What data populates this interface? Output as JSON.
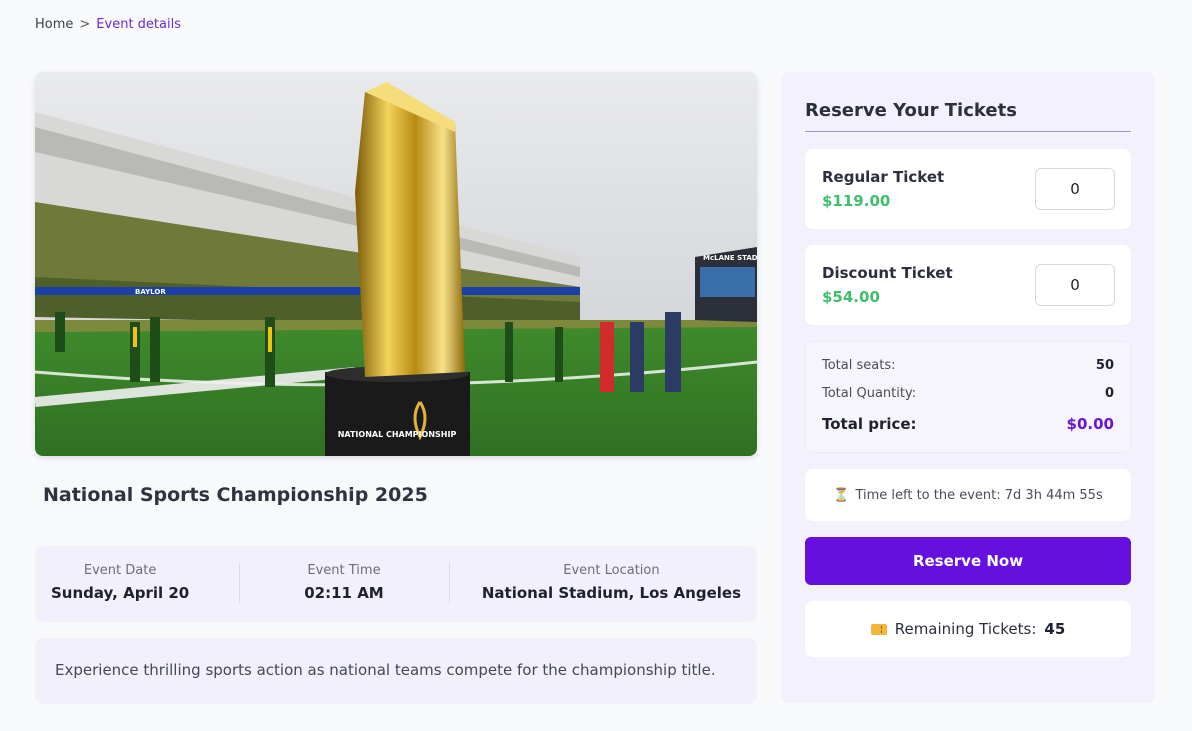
{
  "breadcrumb": {
    "home": "Home",
    "separator": ">",
    "current": "Event details"
  },
  "event": {
    "title": "National Sports Championship 2025",
    "date_label": "Event Date",
    "date_value": "Sunday, April 20",
    "time_label": "Event Time",
    "time_value": "02:11 AM",
    "location_label": "Event Location",
    "location_value": "National Stadium, Los Angeles",
    "description": "Experience thrilling sports action as national teams compete for the championship title.",
    "image_text": {
      "trophy_base": "NATIONAL CHAMPIONSHIP",
      "banner": "BAYLOR",
      "scoreboard": "McLANE STADIUM"
    }
  },
  "reserve": {
    "title": "Reserve Your Tickets",
    "tickets": [
      {
        "name": "Regular Ticket",
        "price": "$119.00",
        "quantity": "0"
      },
      {
        "name": "Discount Ticket",
        "price": "$54.00",
        "quantity": "0"
      }
    ],
    "summary": {
      "seats_label": "Total seats:",
      "seats_value": "50",
      "quantity_label": "Total Quantity:",
      "quantity_value": "0",
      "price_label": "Total price:",
      "price_value": "$0.00"
    },
    "countdown_icon": "hourglass-icon",
    "countdown_text": "Time left to the event: 7d 3h 44m 55s",
    "button_label": "Reserve Now",
    "remaining_icon": "ticket-icon",
    "remaining_label": "Remaining Tickets:",
    "remaining_value": "45"
  },
  "colors": {
    "accent": "#6610e0",
    "price_green": "#3fbf6b",
    "panel_bg": "#f3f1fb"
  }
}
